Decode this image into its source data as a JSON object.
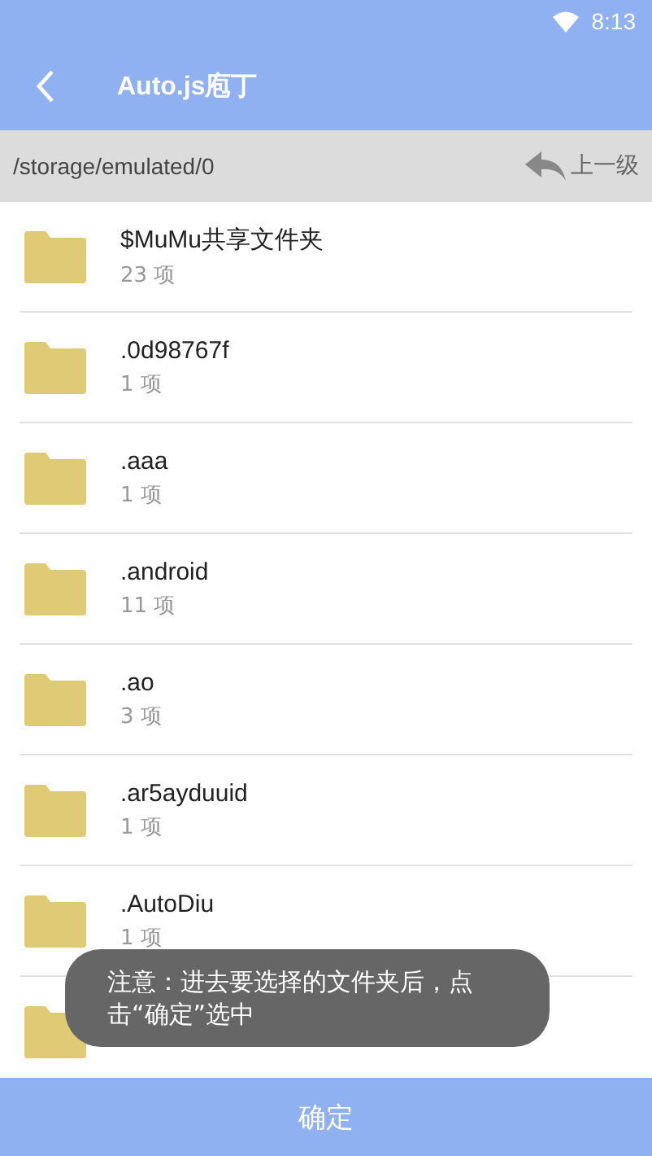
{
  "status_bar": {
    "time": "8:13"
  },
  "app_bar": {
    "title": "Auto.js庖丁"
  },
  "path_bar": {
    "path": "/storage/emulated/0",
    "up_label": "上一级"
  },
  "folders": [
    {
      "kind": "labeled",
      "name": "$MuMu共享文件夹",
      "count": "23 项"
    },
    {
      "kind": "labeled",
      "name": ".0d98767f",
      "count": "1 项"
    },
    {
      "kind": "labeled",
      "name": ".aaa",
      "count": "1 项"
    },
    {
      "kind": "labeled",
      "name": ".android",
      "count": "11 项"
    },
    {
      "kind": "labeled",
      "name": ".ao",
      "count": "3 项"
    },
    {
      "kind": "labeled",
      "name": ".ar5ayduuid",
      "count": "1 项"
    },
    {
      "kind": "labeled",
      "name": ".AutoDiu",
      "count": "1 项"
    },
    {
      "kind": "covered"
    }
  ],
  "toast": {
    "text": "注意：进去要选择的文件夹后，点击“确定”选中"
  },
  "confirm_button": {
    "label": "确定"
  }
}
